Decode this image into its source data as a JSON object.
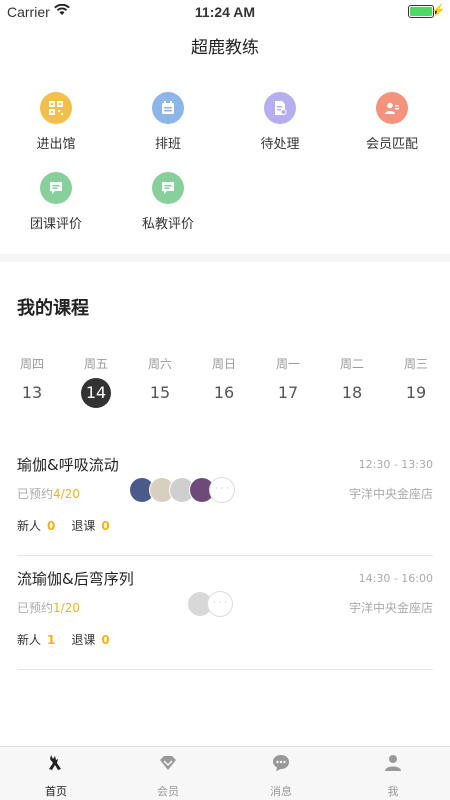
{
  "status_bar": {
    "carrier": "Carrier",
    "time": "11:24 AM"
  },
  "nav": {
    "title": "超鹿教练"
  },
  "menu": [
    {
      "label": "进出馆",
      "icon": "qr-code-icon",
      "color": "#f2c04a"
    },
    {
      "label": "排班",
      "icon": "calendar-icon",
      "color": "#8db5e8"
    },
    {
      "label": "待处理",
      "icon": "pending-doc-icon",
      "color": "#b7aef0"
    },
    {
      "label": "会员匹配",
      "icon": "member-card-icon",
      "color": "#f3927d"
    },
    {
      "label": "团课评价",
      "icon": "comment-icon",
      "color": "#88cf9b"
    },
    {
      "label": "私教评价",
      "icon": "comment-icon",
      "color": "#88cf9b"
    }
  ],
  "courses_section": {
    "title": "我的课程"
  },
  "week": [
    {
      "weekday": "周四",
      "date": "13"
    },
    {
      "weekday": "周五",
      "date": "14",
      "selected": true
    },
    {
      "weekday": "周六",
      "date": "15"
    },
    {
      "weekday": "周日",
      "date": "16"
    },
    {
      "weekday": "周一",
      "date": "17"
    },
    {
      "weekday": "周二",
      "date": "18"
    },
    {
      "weekday": "周三",
      "date": "19"
    }
  ],
  "courses": [
    {
      "name": "瑜伽&呼吸流动",
      "time": "12:30 - 13:30",
      "booked_label": "已预约",
      "booked_count": "4/20",
      "store": "宇洋中央金座店",
      "new_label": "新人",
      "new_count": "0",
      "cancel_label": "退课",
      "cancel_count": "0",
      "avatar_colors": [
        "#4a5a8a",
        "#d9cfc0",
        "#cfcfcf",
        "#6c4a7a"
      ]
    },
    {
      "name": "流瑜伽&后弯序列",
      "time": "14:30 - 16:00",
      "booked_label": "已预约",
      "booked_count": "1/20",
      "store": "宇洋中央金座店",
      "new_label": "新人",
      "new_count": "1",
      "cancel_label": "退课",
      "cancel_count": "0",
      "avatar_colors": [
        "#d8d8d8"
      ]
    }
  ],
  "avatar_more": "· · ·",
  "tabbar": [
    {
      "label": "首页",
      "icon": "deer-icon",
      "active": true
    },
    {
      "label": "会员",
      "icon": "diamond-icon"
    },
    {
      "label": "消息",
      "icon": "chat-icon"
    },
    {
      "label": "我",
      "icon": "person-icon"
    }
  ]
}
